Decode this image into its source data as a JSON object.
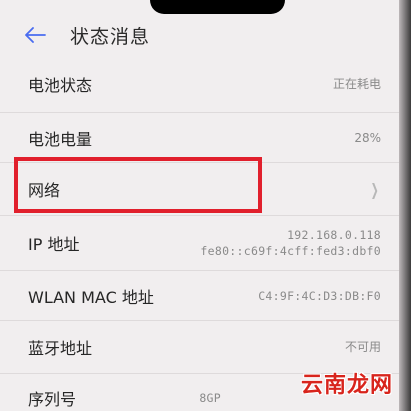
{
  "header": {
    "title": "状态消息",
    "back_icon": "back-arrow-icon"
  },
  "accent_color": "#4a6cf0",
  "highlight_color": "#e11f2c",
  "rows": [
    {
      "id": "battery-status",
      "label": "电池状态",
      "value": "正在耗电"
    },
    {
      "id": "battery-level",
      "label": "电池电量",
      "value": "28%"
    },
    {
      "id": "network",
      "label": "网络",
      "value": "",
      "chevron": "chevron-right-icon"
    },
    {
      "id": "ip-address",
      "label": "IP 地址",
      "value_line1": "192.168.0.118",
      "value_line2": "fe80::c69f:4cff:fed3:dbf0"
    },
    {
      "id": "wlan-mac",
      "label": "WLAN MAC 地址",
      "value": "C4:9F:4C:D3:DB:F0"
    },
    {
      "id": "bluetooth-address",
      "label": "蓝牙地址",
      "value": "不可用"
    },
    {
      "id": "serial-number",
      "label": "序列号",
      "value": "8GP"
    }
  ],
  "watermark": "云南龙网"
}
